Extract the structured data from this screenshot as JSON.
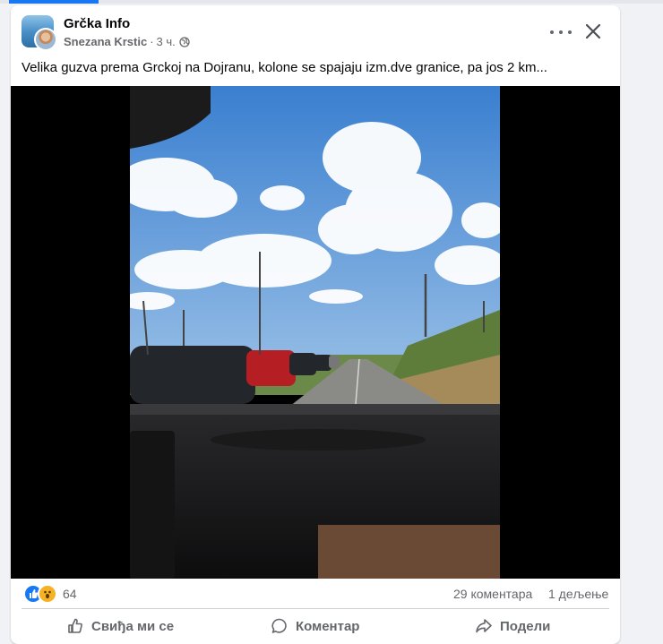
{
  "post": {
    "group_name": "Grčka Info",
    "author": "Snezana Krstic",
    "separator": "·",
    "time": "3 ч.",
    "text": "Velika guzva prema Grckoj na Dojranu, kolone se spajaju izm.dve granice, pa jos 2 km..."
  },
  "stats": {
    "reaction_count": "64",
    "comments": "29 коментара",
    "shares": "1 дељење"
  },
  "actions": {
    "like": "Свиђа ми се",
    "comment": "Коментар",
    "share": "Подели"
  },
  "colors": {
    "accent": "#1877f2",
    "secondary_text": "#65676b",
    "wow": "#f7b125"
  }
}
